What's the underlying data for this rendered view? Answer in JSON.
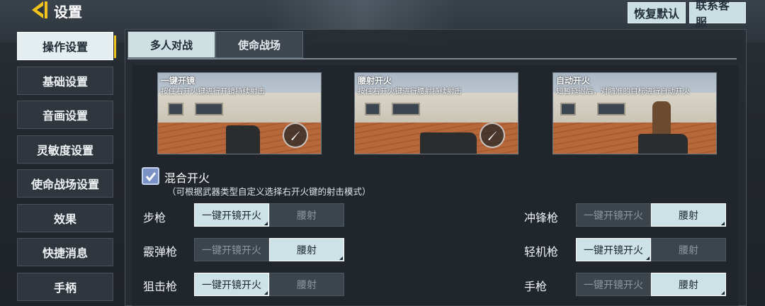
{
  "header": {
    "title": "设置",
    "restore_label": "恢复默认",
    "contact_label": "联系客服"
  },
  "sidebar": {
    "items": [
      {
        "label": "操作设置",
        "active": true
      },
      {
        "label": "基础设置",
        "active": false
      },
      {
        "label": "音画设置",
        "active": false
      },
      {
        "label": "灵敏度设置",
        "active": false
      },
      {
        "label": "使命战场设置",
        "active": false
      },
      {
        "label": "效果",
        "active": false
      },
      {
        "label": "快捷消息",
        "active": false
      },
      {
        "label": "手柄",
        "active": false
      }
    ]
  },
  "tabs": [
    {
      "label": "多人对战",
      "active": true
    },
    {
      "label": "使命战场",
      "active": false
    }
  ],
  "previews": [
    {
      "title": "一键开镜",
      "desc": "按住右开火键进行开镜持续射击"
    },
    {
      "title": "腰射开火",
      "desc": "按住右开火键进行腰射持续射击"
    },
    {
      "title": "自动开火",
      "desc": "短暂延迟后，对瞄准的目标进行自动开火"
    }
  ],
  "mixed_fire": {
    "label": "混合开火",
    "checked": true,
    "sub": "（可根据武器类型自定义选择右开火键的射击模式）"
  },
  "options": {
    "scope": "一键开镜开火",
    "hip": "腰射"
  },
  "weapons": {
    "rifle": {
      "label": "步枪",
      "selected": "scope"
    },
    "shotgun": {
      "label": "霰弹枪",
      "selected": "hip"
    },
    "sniper": {
      "label": "狙击枪",
      "selected": "scope"
    },
    "smg": {
      "label": "冲锋枪",
      "selected": "hip"
    },
    "lmg": {
      "label": "轻机枪",
      "selected": "scope"
    },
    "pistol": {
      "label": "手枪",
      "selected": "hip"
    }
  },
  "colors": {
    "accent_yellow": "#f1c21b",
    "active_tab": "#cfe0e3",
    "checkbox": "#7b92c7"
  }
}
